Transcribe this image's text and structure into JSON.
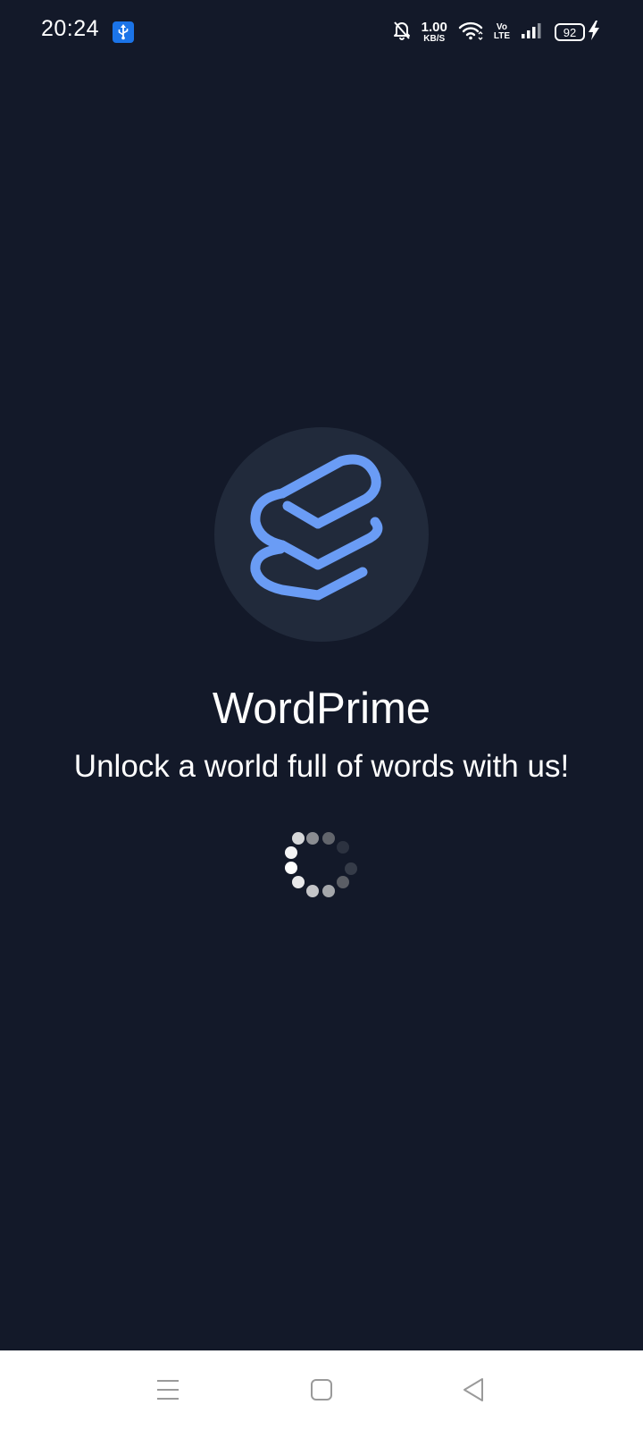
{
  "status_bar": {
    "time": "20:24",
    "net_speed_value": "1.00",
    "net_speed_unit": "KB/S",
    "volte_top": "Vo",
    "volte_bottom": "LTE",
    "battery_level": "92",
    "icons": [
      "usb-icon",
      "bell-off-icon",
      "wifi-icon",
      "signal-icon",
      "charging-icon"
    ]
  },
  "app": {
    "name": "WordPrime",
    "tagline": "Unlock a world full of words with us!",
    "logo_icon": "stacked-books-icon"
  },
  "loading": {
    "indicator": "spinner-icon"
  },
  "nav_bar": {
    "icons": [
      "menu-icon",
      "home-icon",
      "back-icon"
    ]
  },
  "colors": {
    "background": "#131929",
    "logo_circle": "#212a3b",
    "logo_accent": "#6a9cf5",
    "usb_badge": "#1b74e8",
    "nav_background": "#ffffff"
  }
}
